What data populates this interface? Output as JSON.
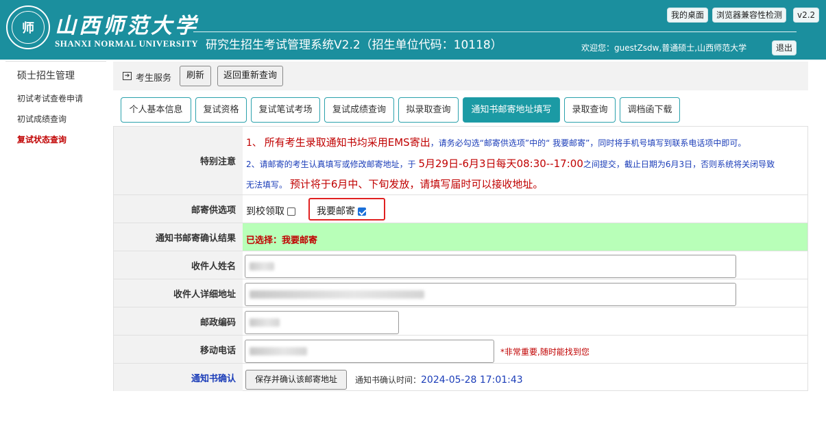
{
  "header": {
    "logo_cn": "山西师范大学",
    "logo_en": "SHANXI NORMAL UNIVERSITY",
    "logo_glyph": "师",
    "system_title": "研究生招生考试管理系统V2.2（招生单位代码：10118）",
    "welcome": "欢迎您：guestZsdw,普通硕士,山西师范大学",
    "btn_desktop": "我的桌面",
    "btn_compat": "浏览器兼容性检测",
    "btn_version": "v2.2",
    "btn_logout": "退出",
    "bg_color": "#1b8f9e"
  },
  "sidebar": {
    "heading": "硕士招生管理",
    "items": [
      {
        "label": "初试考试查卷申请"
      },
      {
        "label": "初试成绩查询"
      },
      {
        "label": "复试状态查询"
      }
    ]
  },
  "crumb": {
    "icon": "arrow-right-icon",
    "label": "考生服务",
    "refresh": "刷新",
    "back": "返回重新查询"
  },
  "tabs": [
    {
      "label": "个人基本信息"
    },
    {
      "label": "复试资格"
    },
    {
      "label": "复试笔试考场"
    },
    {
      "label": "复试成绩查询"
    },
    {
      "label": "拟录取查询"
    },
    {
      "label": "通知书邮寄地址填写"
    },
    {
      "label": "录取查询"
    },
    {
      "label": "调档函下载"
    }
  ],
  "form": {
    "notice_label": "特别注意",
    "notice1_prefix": "1、",
    "notice1_big": "所有考生录取通知书均采用EMS寄出",
    "notice1_rest": "，请务必勾选“邮寄供选项”中的“ 我要邮寄”，同时将手机号填写到联系电话项中即可。",
    "notice2_a": "2、请邮寄的考生认真填写或修改邮寄地址，于 ",
    "notice2_big": "5月29日-6月3日每天08:30--17:00",
    "notice2_b": "之间提交，截止日期为6月3日，否则系统将关闭导致",
    "notice3_a": "无法填写。",
    "notice3_big": "预计将于6月中、下旬发放，请填写届时可以接收地址。",
    "mail_label": "邮寄供选项",
    "opt_pickup": "到校领取",
    "opt_mail": "我要邮寄",
    "result_label": "通知书邮寄确认结果",
    "result_value": "已选择：我要邮寄",
    "name_label": "收件人姓名",
    "addr_label": "收件人详细地址",
    "zip_label": "邮政编码",
    "phone_label": "移动电话",
    "phone_hint": "*非常重要,随时能找到您",
    "confirm_label": "通知书确认",
    "save_btn": "保存并确认该邮寄地址",
    "confirm_time_label": "通知书确认时间：",
    "confirm_time": "2024-05-28 17:01:43",
    "pickup_checked": false,
    "mail_checked": true
  }
}
